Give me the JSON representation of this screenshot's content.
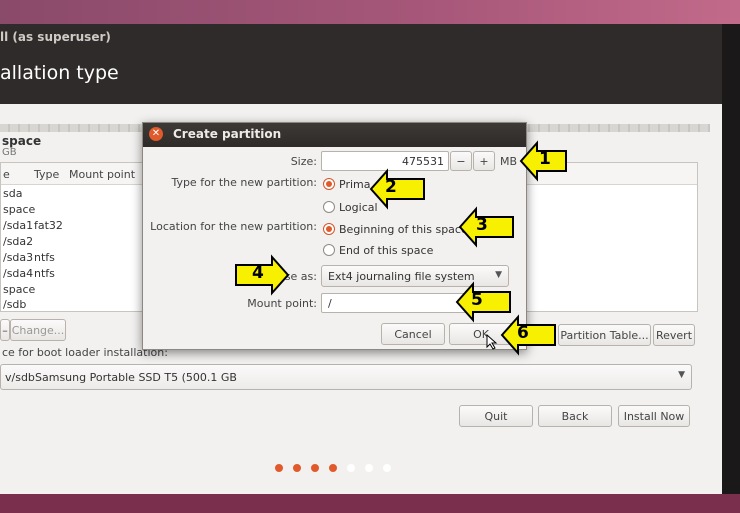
{
  "window": {
    "title": "ll (as superuser)",
    "heading": "allation type"
  },
  "space": {
    "name": "space",
    "size": "GB"
  },
  "table": {
    "headers": [
      "e",
      "Type",
      "Mount point"
    ],
    "rows": [
      {
        "device": "sda",
        "type": ""
      },
      {
        "device": "space",
        "type": ""
      },
      {
        "device": "/sda1",
        "type": "fat32"
      },
      {
        "device": "/sda2",
        "type": ""
      },
      {
        "device": "/sda3",
        "type": "ntfs"
      },
      {
        "device": "/sda4",
        "type": "ntfs"
      },
      {
        "device": "space",
        "type": ""
      },
      {
        "device": "/sdb",
        "type": ""
      }
    ]
  },
  "table_buttons": {
    "minus": "–",
    "change": "Change...",
    "new_table": "Partition Table...",
    "revert": "Revert"
  },
  "boot": {
    "label": "ce for boot loader installation:",
    "device": "v/sdb",
    "name": "Samsung Portable SSD T5 (500.1 GB"
  },
  "nav": {
    "quit": "Quit",
    "back": "Back",
    "install": "Install Now"
  },
  "progress_dots": {
    "total": 7,
    "active": 4,
    "active_color": "#e05a2b",
    "inactive_color": "#ffffff"
  },
  "dialog": {
    "title": "Create partition",
    "size_label": "Size:",
    "size_value": "475531",
    "minus": "−",
    "plus": "+",
    "unit": "MB",
    "type_label": "Type for the new partition:",
    "type_primary": "Prima",
    "type_logical": "Logical",
    "location_label": "Location for the new partition:",
    "loc_begin": "Beginning of this space",
    "loc_end": "End of this space",
    "use_label": "Use as:",
    "use_value": "Ext4 journaling file system",
    "mount_label": "Mount point:",
    "mount_value": "/",
    "cancel": "Cancel",
    "ok": "OK"
  },
  "callouts": [
    "1",
    "2",
    "3",
    "4",
    "5",
    "6"
  ],
  "colors": {
    "accent": "#e05a2b",
    "callout_fill": "#f7f000",
    "titlebar": "#2e2b2a"
  },
  "icons": {
    "close": "close-icon",
    "dropdown": "chevron-down-icon",
    "pointer": "mouse-pointer-icon"
  }
}
